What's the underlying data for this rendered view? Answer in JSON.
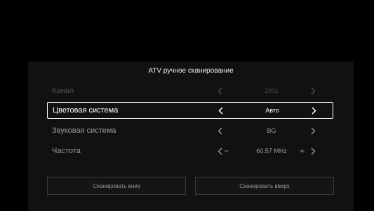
{
  "panel": {
    "title": "ATV ручное сканирование"
  },
  "rows": {
    "channel": {
      "label": "Канал",
      "value": "2001"
    },
    "color_system": {
      "label": "Цветовая система",
      "value": "Авто"
    },
    "sound_system": {
      "label": "Звуковая система",
      "value": "BG"
    },
    "frequency": {
      "label": "Частота",
      "value": "60.57 MHz",
      "minus": "−",
      "plus": "+"
    }
  },
  "buttons": {
    "scan_down": "Сканировать вниз",
    "scan_up": "Сканировать вверх"
  },
  "colors": {
    "background": "#000000",
    "panel": "#111111",
    "text_disabled": "#4f4f4f",
    "text_normal": "#9a9a9a",
    "text_selected": "#ffffff"
  },
  "icons": {
    "prev": "chevron-left-icon",
    "next": "chevron-right-icon"
  }
}
